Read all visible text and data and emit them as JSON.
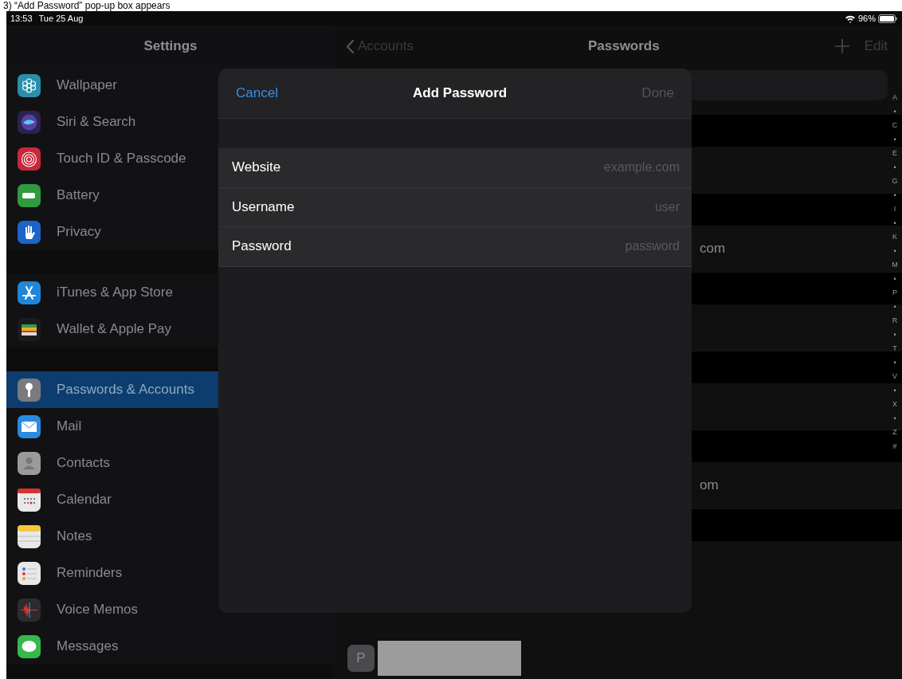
{
  "caption": "3) “Add Password” pop-up box appears",
  "status_bar": {
    "time": "13:53",
    "date": "Tue 25 Aug",
    "battery": "96%"
  },
  "sidebar": {
    "title": "Settings",
    "groups": [
      [
        {
          "label": "Wallpaper",
          "kind": "flower",
          "color": "#2a8fa8",
          "selected": false
        },
        {
          "label": "Siri & Search",
          "kind": "siri",
          "color": "#2a2350",
          "selected": false
        },
        {
          "label": "Touch ID & Passcode",
          "kind": "fingerprint",
          "color": "#c8283c",
          "selected": false
        },
        {
          "label": "Battery",
          "kind": "battery",
          "color": "#2f9a3e",
          "selected": false
        },
        {
          "label": "Privacy",
          "kind": "hand",
          "color": "#1e63c8",
          "selected": false
        }
      ],
      [
        {
          "label": "iTunes & App Store",
          "kind": "appstore",
          "color": "#1f86d8",
          "selected": false
        },
        {
          "label": "Wallet & Apple Pay",
          "kind": "wallet",
          "color": "#1c1c1c",
          "selected": false
        }
      ],
      [
        {
          "label": "Passwords & Accounts",
          "kind": "key",
          "color": "#7a7a80",
          "selected": true
        },
        {
          "label": "Mail",
          "kind": "mail",
          "color": "#2a8ae0",
          "selected": false
        },
        {
          "label": "Contacts",
          "kind": "contacts",
          "color": "#9a9a9a",
          "selected": false
        },
        {
          "label": "Calendar",
          "kind": "calendar",
          "color": "#e8e8e8",
          "selected": false
        },
        {
          "label": "Notes",
          "kind": "notes",
          "color": "#e8e8e8",
          "selected": false
        },
        {
          "label": "Reminders",
          "kind": "reminders",
          "color": "#e8e8e8",
          "selected": false
        },
        {
          "label": "Voice Memos",
          "kind": "voice",
          "color": "#2c2c2e",
          "selected": false
        },
        {
          "label": "Messages",
          "kind": "messages",
          "color": "#35b94c",
          "selected": false
        }
      ]
    ]
  },
  "passwords": {
    "back": "Accounts",
    "title": "Passwords",
    "edit": "Edit",
    "rows": [
      {
        "kind": "header"
      },
      {
        "kind": "row"
      },
      {
        "kind": "header"
      },
      {
        "kind": "row",
        "text": "com"
      },
      {
        "kind": "header"
      },
      {
        "kind": "row"
      },
      {
        "kind": "header"
      },
      {
        "kind": "row"
      },
      {
        "kind": "header"
      },
      {
        "kind": "row",
        "text": "om"
      },
      {
        "kind": "header"
      },
      {
        "kind": "row"
      },
      {
        "kind": "row"
      },
      {
        "kind": "account",
        "initial": "P"
      }
    ],
    "index": [
      "A",
      "•",
      "C",
      "•",
      "E",
      "•",
      "G",
      "•",
      "I",
      "•",
      "K",
      "•",
      "M",
      "•",
      "P",
      "•",
      "R",
      "•",
      "T",
      "•",
      "V",
      "•",
      "X",
      "•",
      "Z",
      "#"
    ]
  },
  "dialog": {
    "title": "Add Password",
    "cancel": "Cancel",
    "done": "Done",
    "done_disabled": true,
    "fields": [
      {
        "label": "Website",
        "placeholder": "example.com"
      },
      {
        "label": "Username",
        "placeholder": "user"
      },
      {
        "label": "Password",
        "placeholder": "password"
      }
    ]
  }
}
